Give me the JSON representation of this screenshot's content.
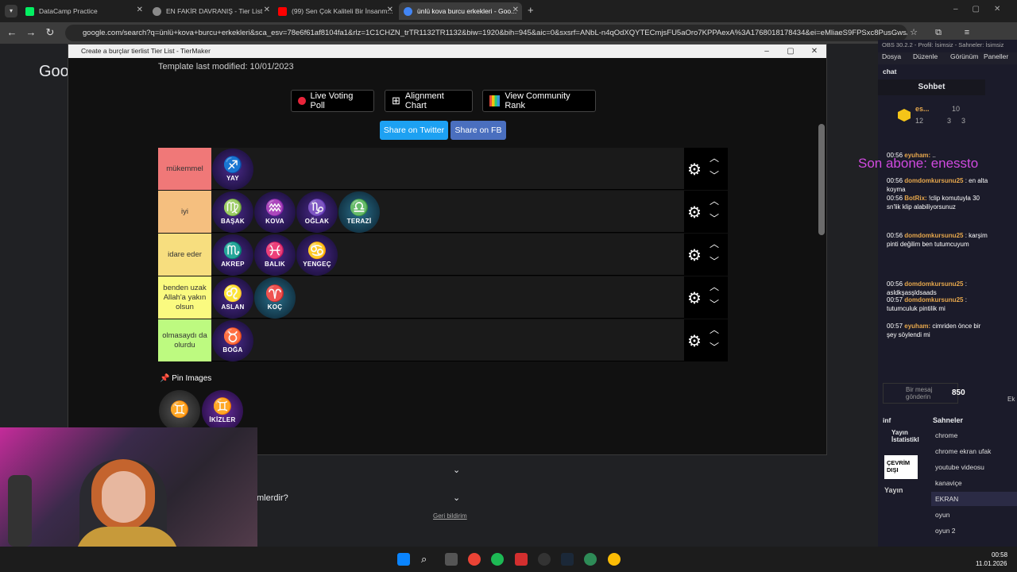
{
  "browser": {
    "tabs": [
      {
        "label": "DataCamp Practice",
        "color": "#03ef62"
      },
      {
        "label": "EN FAKİR DAVRANIŞ - Tier List",
        "color": "#8a8a8a"
      },
      {
        "label": "(99) Sen Çok Kaliteli Bir İnsanm...",
        "color": "#ff0000"
      },
      {
        "label": "ünlü kova burcu erkekleri - Goo...",
        "color": "#4285f4"
      }
    ],
    "new_tab": "+",
    "url": "google.com/search?q=ünlü+kova+burcu+erkekleri&sca_esv=78e6f61af8104fa1&rlz=1C1CHZN_trTR1132TR1132&biw=1920&bih=945&aic=0&sxsrf=ANbL-n4qOdXQYTECmjsFU5aOro7KPPAexA%3A1768018178434&ei=eMliaeS9FPSxc8PusGwsAY...",
    "page_logo": "Goo"
  },
  "popup": {
    "title": "Create a burçlar tierlist Tier List - TierMaker",
    "template_modified": "Template last modified: 10/01/2023",
    "buttons": {
      "live": "Live Voting Poll",
      "align": "Alignment Chart",
      "community": "View Community Rank"
    },
    "share": {
      "twitter": "Share on Twitter",
      "fb": "Share on FB"
    },
    "tiers": [
      {
        "label": "mükemmel",
        "color": "#f07878",
        "items": [
          {
            "glyph": "♐",
            "name": "YAY"
          }
        ]
      },
      {
        "label": "iyi",
        "color": "#f5bf7f",
        "items": [
          {
            "glyph": "♍",
            "name": "BAŞAK"
          },
          {
            "glyph": "♒",
            "name": "KOVA"
          },
          {
            "glyph": "♑",
            "name": "OĞLAK"
          },
          {
            "glyph": "♎",
            "name": "TERAZİ"
          }
        ]
      },
      {
        "label": "idare eder",
        "color": "#f7de7f",
        "items": [
          {
            "glyph": "♏",
            "name": "AKREP"
          },
          {
            "glyph": "♓",
            "name": "BALIK"
          },
          {
            "glyph": "♋",
            "name": "YENGEÇ"
          }
        ]
      },
      {
        "label": "benden uzak Allah'a yakın olsun",
        "color": "#fafa80",
        "items": [
          {
            "glyph": "♌",
            "name": "ASLAN"
          },
          {
            "glyph": "♈",
            "name": "KOÇ"
          }
        ]
      },
      {
        "label": "olmasaydı da olurdu",
        "color": "#bdfa80",
        "items": [
          {
            "glyph": "♉",
            "name": "BOĞA"
          }
        ]
      }
    ],
    "pin_label": "Pin Images",
    "pinned": [
      {
        "glyph": "♊",
        "name": ""
      },
      {
        "glyph": "♊",
        "name": "İKİZLER"
      }
    ]
  },
  "page_below": {
    "question": "mlerdir?",
    "feedback": "Geri bildirim"
  },
  "obs": {
    "title": "OBS 30.2.2 - Profil: İsimsiz - Sahneler: İsimsiz",
    "menu": [
      "Dosya",
      "Düzenle",
      "Görünüm",
      "Paneller"
    ],
    "chat_header": "chat",
    "sohbet": "Sohbet",
    "user_short": "es...",
    "stats": [
      "10",
      "12",
      "3",
      "3"
    ],
    "subscriber_overlay": "Son abone: enessto",
    "messages": [
      {
        "time": "00:56",
        "user": "eyuham:",
        "text": ".."
      },
      {
        "time": "00:56",
        "user": "domdomkursunu25",
        "text": ": en alta koyma"
      },
      {
        "time": "00:56",
        "user": "BotRix:",
        "text": "!clip komutuyla 30 sn'lik klip alabiliyorsunuz"
      },
      {
        "time": "00:56",
        "user": "domdomkursunu25",
        "text": ": karşim pinti değilim ben tutumcuyum"
      },
      {
        "time": "00:56",
        "user": "domdomkursunu25",
        "text": ": asldkşasşldsaads"
      },
      {
        "time": "00:57",
        "user": "domdomkursunu25",
        "text": ": tutumculuk pintilik mi"
      },
      {
        "time": "00:57",
        "user": "eyuham:",
        "text": "cimriden önce bir şey söylendi mi"
      }
    ],
    "send_placeholder": "Bir mesaj gönderin",
    "points": "850",
    "info_label": "inf",
    "yayin_stats": "Yayın İstatistikl",
    "offline": "ÇEVRİM DIŞI",
    "yayin": "Yayın",
    "scenes_header": "Sahneler",
    "scenes": [
      "chrome",
      "chrome ekran ufak",
      "youtube videosu",
      "kanaviçe",
      "EKRAN",
      "oyun",
      "oyun 2"
    ],
    "selected_scene": "EKRAN",
    "right_edge": "Ek"
  },
  "taskbar": {
    "time": "00:58",
    "date": "11.01.2026"
  }
}
